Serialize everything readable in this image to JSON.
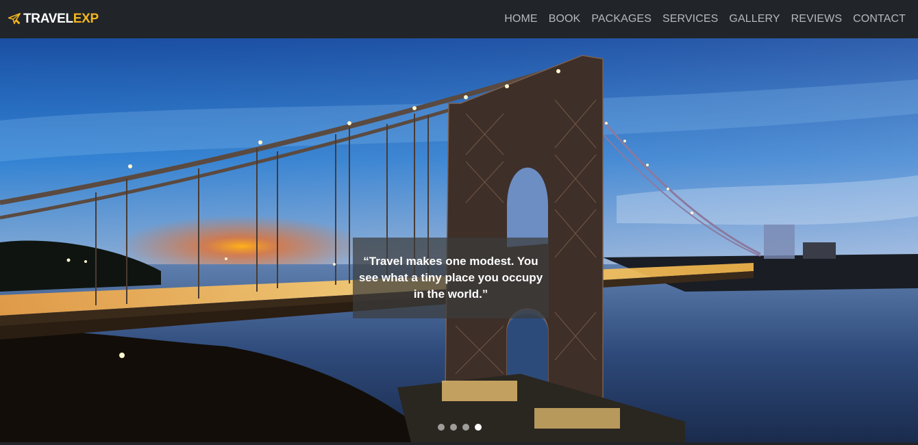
{
  "brand": {
    "part1": "TRAVEL",
    "part2": "EXP",
    "icon": "plane-icon",
    "accent": "#f5b51f"
  },
  "nav": {
    "items": [
      "HOME",
      "BOOK",
      "PACKAGES",
      "SERVICES",
      "GALLERY",
      "REVIEWS",
      "CONTACT"
    ]
  },
  "hero": {
    "image": "bridge-at-sunset",
    "quote": "“Travel makes one modest. You see what a tiny place you occupy in the world.”",
    "slides_total": 4,
    "active_slide": 4
  },
  "colors": {
    "navbar_bg": "#212529",
    "nav_text": "#b5b9bd"
  }
}
